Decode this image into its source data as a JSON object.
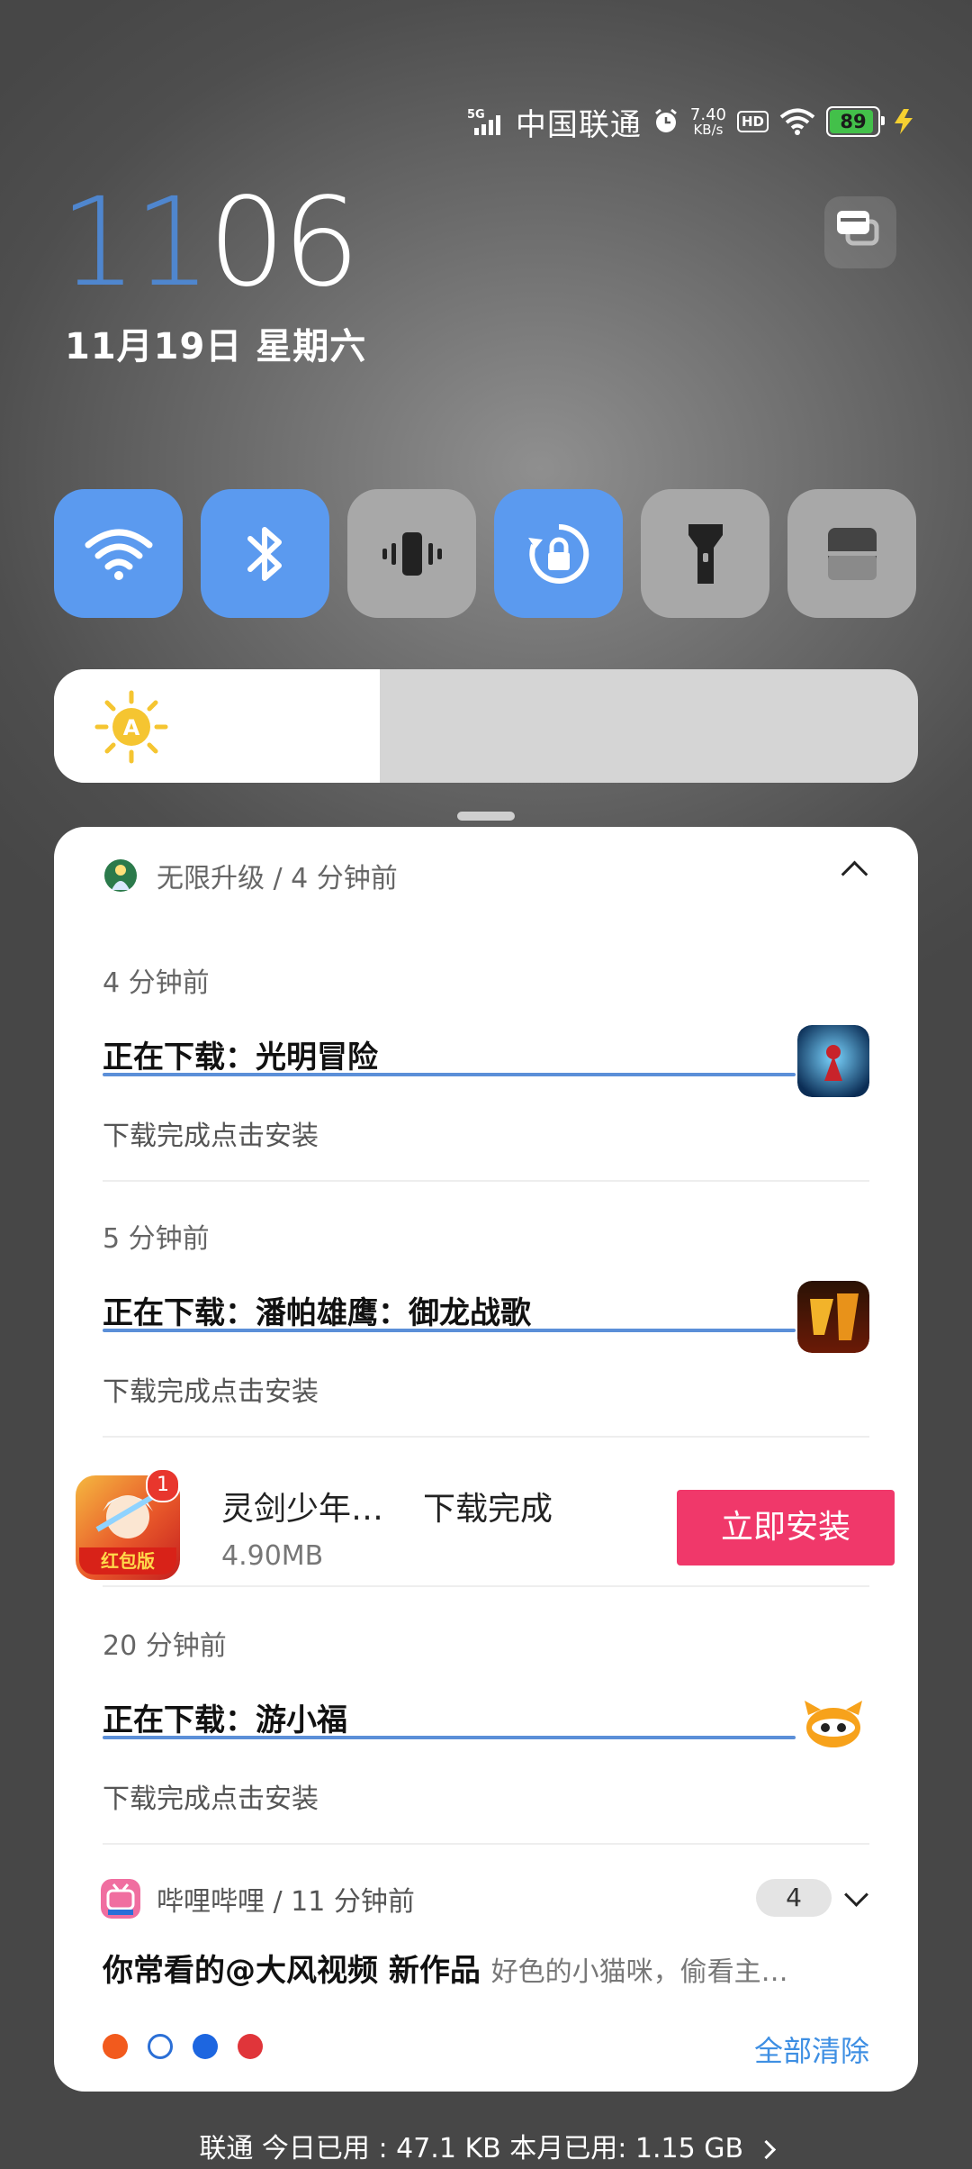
{
  "status_bar": {
    "network": "5G",
    "carrier": "中国联通",
    "speed_value": "7.40",
    "speed_unit": "KB/s",
    "hd": "HD",
    "battery": "89",
    "icons": [
      "signal-icon",
      "alarm-icon",
      "hd-icon",
      "wifi-icon",
      "battery-icon",
      "charging-icon"
    ]
  },
  "clock": {
    "hour": "11",
    "minute": "06",
    "date": "11月19日 星期六"
  },
  "quick_tiles": [
    {
      "name": "wifi",
      "icon": "wifi-icon",
      "on": true
    },
    {
      "name": "bluetooth",
      "icon": "bluetooth-icon",
      "on": true
    },
    {
      "name": "vibrate",
      "icon": "vibrate-icon",
      "on": false
    },
    {
      "name": "rotation-lock",
      "icon": "rotation-lock-icon",
      "on": true
    },
    {
      "name": "flashlight",
      "icon": "flashlight-icon",
      "on": false
    },
    {
      "name": "more",
      "icon": "panel-icon",
      "on": false
    }
  ],
  "brightness": {
    "level": 0.377,
    "icon": "auto-brightness-icon",
    "auto_label": "A"
  },
  "notifications": {
    "group_title": "无限升级 / 4 分钟前",
    "items": [
      {
        "time": "4 分钟前",
        "title": "正在下载：光明冒险",
        "sub": "下载完成点击安装"
      },
      {
        "time": "5 分钟前",
        "title": "正在下载：潘帕雄鹰：御龙战歌",
        "sub": "下载完成点击安装"
      },
      {
        "time": "20 分钟前",
        "title": "正在下载：游小福",
        "sub": "下载完成点击安装"
      }
    ],
    "ad": {
      "name": "灵剑少年…",
      "status": "下载完成",
      "size": "4.90MB",
      "button": "立即安装",
      "badge": "1",
      "tag": "红包版"
    },
    "bilibili": {
      "header": "哔哩哔哩 / 11 分钟前",
      "count": "4",
      "headline": "你常看的@大风视频 新作品",
      "preview": "好色的小猫咪，偷看主…",
      "line2": "…"
    },
    "clear_all": "全部清除"
  },
  "data_usage": "联通 今日已用 : 47.1 KB 本月已用: 1.15 GB",
  "colors": {
    "accent": "#5b9aef",
    "install": "#f0386a",
    "clear": "#3e8fe3",
    "progress": "#5b8fd8"
  }
}
